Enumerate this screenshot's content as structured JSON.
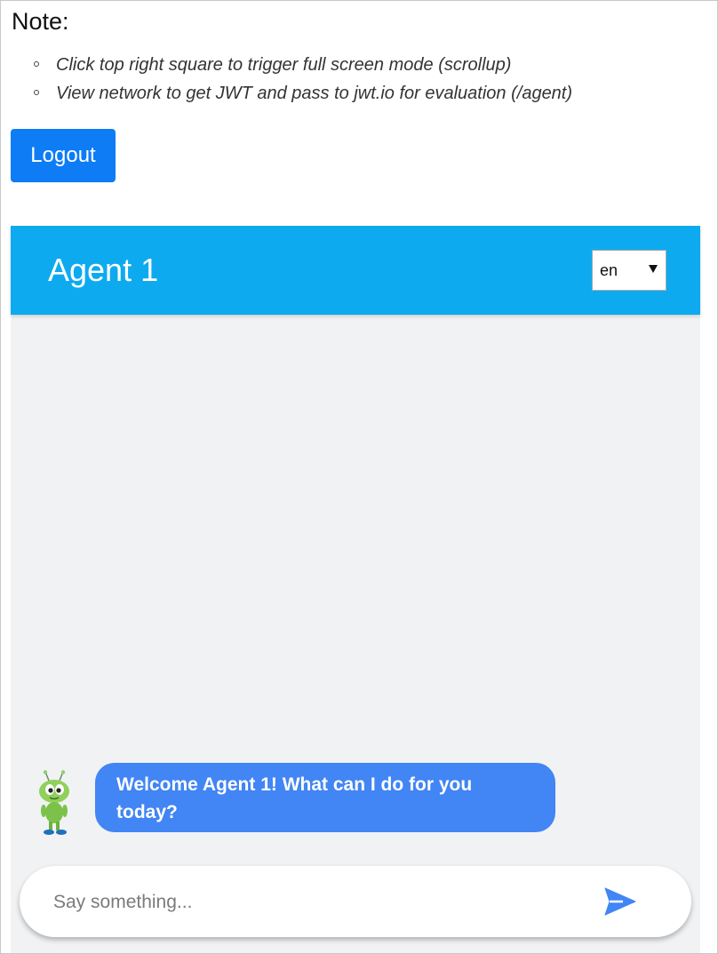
{
  "note": {
    "title": "Note:",
    "items": [
      "Click top right square to trigger full screen mode (scrollup)",
      "View network to get JWT and pass to jwt.io for evaluation (/agent)"
    ]
  },
  "logout": {
    "label": "Logout",
    "color": "#0d7cf5"
  },
  "chat": {
    "header": {
      "title": "Agent 1",
      "color": "#0eaaf0"
    },
    "language": {
      "selected": "en"
    },
    "messages": [
      {
        "sender": "bot",
        "avatar_icon": "robot-avatar-icon",
        "text": "Welcome Agent 1! What can I do for you today?",
        "color": "#4285f4"
      }
    ],
    "input": {
      "placeholder": "Say something...",
      "value": ""
    },
    "send_icon": "send-icon",
    "background": "#f1f2f4"
  }
}
